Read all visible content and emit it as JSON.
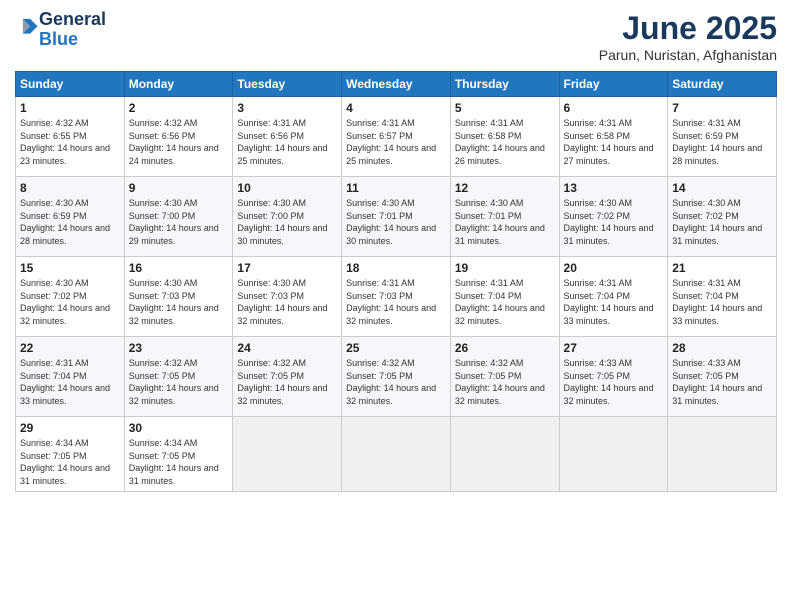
{
  "header": {
    "logo_general": "General",
    "logo_blue": "Blue",
    "month": "June 2025",
    "location": "Parun, Nuristan, Afghanistan"
  },
  "days_of_week": [
    "Sunday",
    "Monday",
    "Tuesday",
    "Wednesday",
    "Thursday",
    "Friday",
    "Saturday"
  ],
  "weeks": [
    [
      {
        "num": "1",
        "sunrise": "4:32 AM",
        "sunset": "6:55 PM",
        "daylight": "14 hours and 23 minutes."
      },
      {
        "num": "2",
        "sunrise": "4:32 AM",
        "sunset": "6:56 PM",
        "daylight": "14 hours and 24 minutes."
      },
      {
        "num": "3",
        "sunrise": "4:31 AM",
        "sunset": "6:56 PM",
        "daylight": "14 hours and 25 minutes."
      },
      {
        "num": "4",
        "sunrise": "4:31 AM",
        "sunset": "6:57 PM",
        "daylight": "14 hours and 25 minutes."
      },
      {
        "num": "5",
        "sunrise": "4:31 AM",
        "sunset": "6:58 PM",
        "daylight": "14 hours and 26 minutes."
      },
      {
        "num": "6",
        "sunrise": "4:31 AM",
        "sunset": "6:58 PM",
        "daylight": "14 hours and 27 minutes."
      },
      {
        "num": "7",
        "sunrise": "4:31 AM",
        "sunset": "6:59 PM",
        "daylight": "14 hours and 28 minutes."
      }
    ],
    [
      {
        "num": "8",
        "sunrise": "4:30 AM",
        "sunset": "6:59 PM",
        "daylight": "14 hours and 28 minutes."
      },
      {
        "num": "9",
        "sunrise": "4:30 AM",
        "sunset": "7:00 PM",
        "daylight": "14 hours and 29 minutes."
      },
      {
        "num": "10",
        "sunrise": "4:30 AM",
        "sunset": "7:00 PM",
        "daylight": "14 hours and 30 minutes."
      },
      {
        "num": "11",
        "sunrise": "4:30 AM",
        "sunset": "7:01 PM",
        "daylight": "14 hours and 30 minutes."
      },
      {
        "num": "12",
        "sunrise": "4:30 AM",
        "sunset": "7:01 PM",
        "daylight": "14 hours and 31 minutes."
      },
      {
        "num": "13",
        "sunrise": "4:30 AM",
        "sunset": "7:02 PM",
        "daylight": "14 hours and 31 minutes."
      },
      {
        "num": "14",
        "sunrise": "4:30 AM",
        "sunset": "7:02 PM",
        "daylight": "14 hours and 31 minutes."
      }
    ],
    [
      {
        "num": "15",
        "sunrise": "4:30 AM",
        "sunset": "7:02 PM",
        "daylight": "14 hours and 32 minutes."
      },
      {
        "num": "16",
        "sunrise": "4:30 AM",
        "sunset": "7:03 PM",
        "daylight": "14 hours and 32 minutes."
      },
      {
        "num": "17",
        "sunrise": "4:30 AM",
        "sunset": "7:03 PM",
        "daylight": "14 hours and 32 minutes."
      },
      {
        "num": "18",
        "sunrise": "4:31 AM",
        "sunset": "7:03 PM",
        "daylight": "14 hours and 32 minutes."
      },
      {
        "num": "19",
        "sunrise": "4:31 AM",
        "sunset": "7:04 PM",
        "daylight": "14 hours and 32 minutes."
      },
      {
        "num": "20",
        "sunrise": "4:31 AM",
        "sunset": "7:04 PM",
        "daylight": "14 hours and 33 minutes."
      },
      {
        "num": "21",
        "sunrise": "4:31 AM",
        "sunset": "7:04 PM",
        "daylight": "14 hours and 33 minutes."
      }
    ],
    [
      {
        "num": "22",
        "sunrise": "4:31 AM",
        "sunset": "7:04 PM",
        "daylight": "14 hours and 33 minutes."
      },
      {
        "num": "23",
        "sunrise": "4:32 AM",
        "sunset": "7:05 PM",
        "daylight": "14 hours and 32 minutes."
      },
      {
        "num": "24",
        "sunrise": "4:32 AM",
        "sunset": "7:05 PM",
        "daylight": "14 hours and 32 minutes."
      },
      {
        "num": "25",
        "sunrise": "4:32 AM",
        "sunset": "7:05 PM",
        "daylight": "14 hours and 32 minutes."
      },
      {
        "num": "26",
        "sunrise": "4:32 AM",
        "sunset": "7:05 PM",
        "daylight": "14 hours and 32 minutes."
      },
      {
        "num": "27",
        "sunrise": "4:33 AM",
        "sunset": "7:05 PM",
        "daylight": "14 hours and 32 minutes."
      },
      {
        "num": "28",
        "sunrise": "4:33 AM",
        "sunset": "7:05 PM",
        "daylight": "14 hours and 31 minutes."
      }
    ],
    [
      {
        "num": "29",
        "sunrise": "4:34 AM",
        "sunset": "7:05 PM",
        "daylight": "14 hours and 31 minutes."
      },
      {
        "num": "30",
        "sunrise": "4:34 AM",
        "sunset": "7:05 PM",
        "daylight": "14 hours and 31 minutes."
      },
      null,
      null,
      null,
      null,
      null
    ]
  ]
}
